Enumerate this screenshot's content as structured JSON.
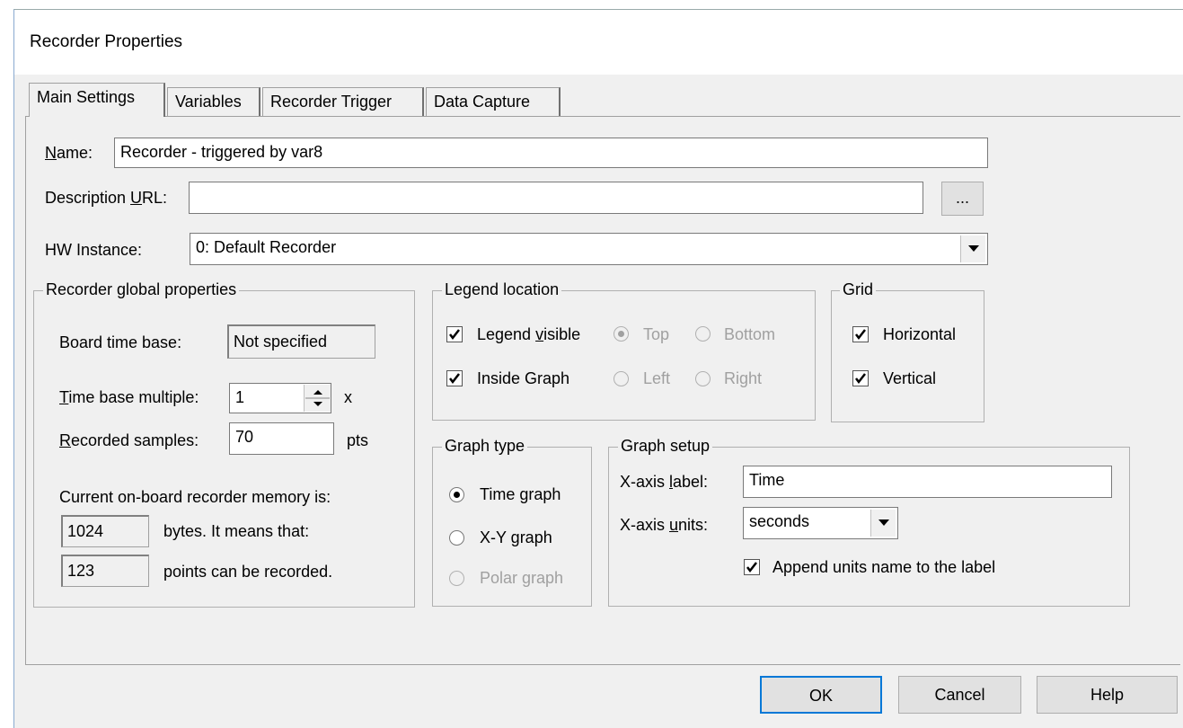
{
  "window": {
    "title": "Recorder Properties"
  },
  "tabs": [
    {
      "label": "Main Settings"
    },
    {
      "label": "Variables"
    },
    {
      "label": "Recorder Trigger"
    },
    {
      "label": "Data Capture"
    }
  ],
  "main": {
    "name_label": "Name:",
    "name_value": "Recorder - triggered by var8",
    "description_label": "Description URL:",
    "description_value": "",
    "browse_label": "...",
    "hw_instance_label": "HW Instance:",
    "hw_instance_value": "0: Default Recorder"
  },
  "global_props": {
    "title": "Recorder global properties",
    "board_time_base_label": "Board time base:",
    "board_time_base_value": "Not specified",
    "time_base_multiple_label": "Time base multiple:",
    "time_base_multiple_value": "1",
    "time_base_multiple_unit": "x",
    "recorded_samples_label": "Recorded samples:",
    "recorded_samples_value": "70",
    "recorded_samples_unit": "pts",
    "memory_text": "Current on-board recorder memory is:",
    "bytes_value": "1024",
    "bytes_text": "bytes. It means that:",
    "points_value": "123",
    "points_text": "points can be recorded."
  },
  "legend": {
    "title": "Legend location",
    "visible_label": "Legend visible",
    "visible_checked": true,
    "inside_label": "Inside Graph",
    "inside_checked": true,
    "top_label": "Top",
    "bottom_label": "Bottom",
    "left_label": "Left",
    "right_label": "Right"
  },
  "grid": {
    "title": "Grid",
    "horizontal_label": "Horizontal",
    "horizontal_checked": true,
    "vertical_label": "Vertical",
    "vertical_checked": true
  },
  "graph_type": {
    "title": "Graph type",
    "options": [
      {
        "label": "Time graph",
        "selected": true,
        "enabled": true
      },
      {
        "label": "X-Y graph",
        "selected": false,
        "enabled": true
      },
      {
        "label": "Polar graph",
        "selected": false,
        "enabled": false
      }
    ]
  },
  "graph_setup": {
    "title": "Graph setup",
    "xaxis_label_label": "X-axis label:",
    "xaxis_label_value": "Time",
    "xaxis_units_label": "X-axis units:",
    "xaxis_units_value": "seconds",
    "append_label": "Append units name to the label",
    "append_checked": true
  },
  "buttons": {
    "ok": "OK",
    "cancel": "Cancel",
    "help": "Help"
  }
}
